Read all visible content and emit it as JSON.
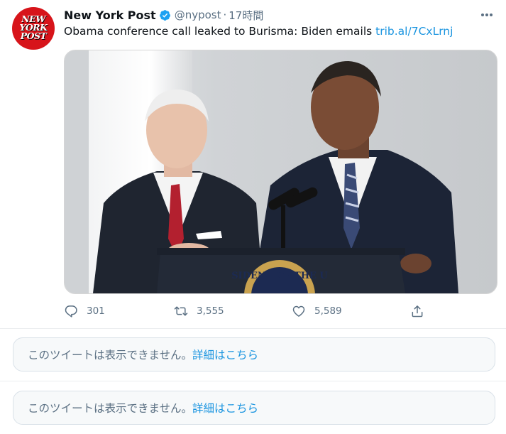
{
  "tweet": {
    "avatar_text": [
      "NEW",
      "YORK",
      "POST"
    ],
    "display_name": "New York Post",
    "handle": "@nypost",
    "separator": "·",
    "time": "17時間",
    "text": "Obama conference call leaked to Burisma: Biden emails ",
    "link": "trib.al/7CxLrnj",
    "image_podium_text": "SIDENT OF THE U",
    "reply_count": "301",
    "retweet_count": "3,555",
    "like_count": "5,589"
  },
  "notices": [
    {
      "text": "このツイートは表示できません。",
      "link": "詳細はこちら"
    },
    {
      "text": "このツイートは表示できません。",
      "link": "詳細はこちら"
    }
  ],
  "colors": {
    "accent": "#1b95e0",
    "secondary_text": "#5b7083",
    "avatar_red": "#d7141a",
    "verified": "#1da1f2"
  }
}
